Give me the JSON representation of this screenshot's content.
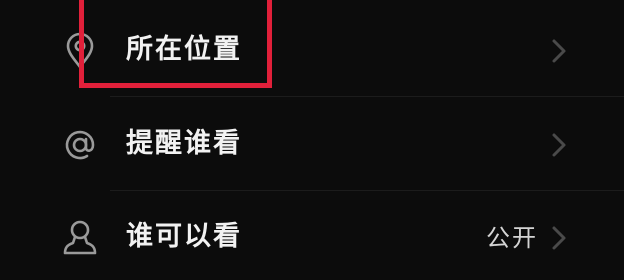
{
  "settings": {
    "items": [
      {
        "id": "location",
        "label": "所在位置",
        "icon": "location-pin-icon",
        "value": ""
      },
      {
        "id": "mention",
        "label": "提醒谁看",
        "icon": "at-sign-icon",
        "value": ""
      },
      {
        "id": "visibility",
        "label": "谁可以看",
        "icon": "person-icon",
        "value": "公开"
      }
    ]
  },
  "annotation": {
    "highlight_color": "#e1203a",
    "highlighted_item": "location"
  },
  "colors": {
    "background": "#0c0c0c",
    "label_text": "#f2f2f2",
    "value_text": "#d4d4d4",
    "icon": "#9a9a9a",
    "chevron": "#4a4a4a"
  }
}
